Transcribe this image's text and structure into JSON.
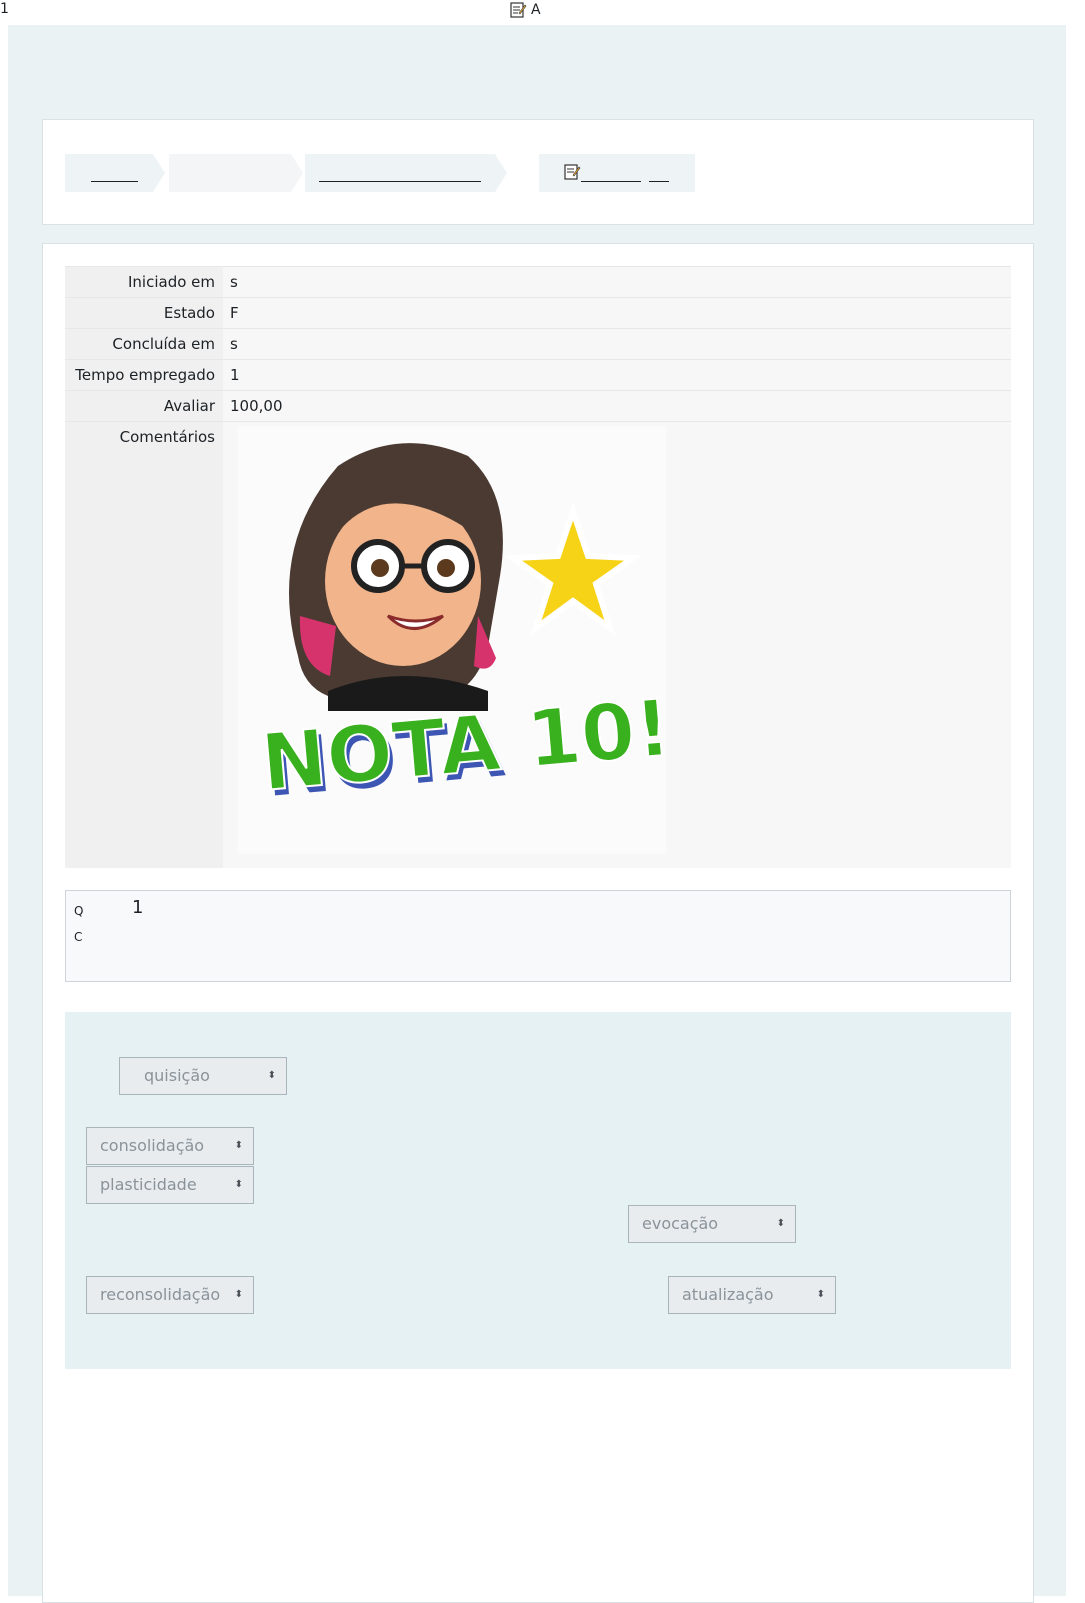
{
  "top": {
    "page_number": "1",
    "title": "A"
  },
  "icons": {
    "quiz": "quiz-icon"
  },
  "summary": [
    {
      "label": "Iniciado em",
      "value": "s"
    },
    {
      "label": "Estado",
      "value": "F"
    },
    {
      "label": "Concluída em",
      "value": "s"
    },
    {
      "label": "Tempo empregado",
      "value": "1"
    },
    {
      "label": "Avaliar",
      "value": "100,00"
    },
    {
      "label": "Comentários",
      "value": ""
    }
  ],
  "sticker": {
    "text": "NOTA 10!"
  },
  "question": {
    "q_label": "Q",
    "number": "1",
    "c_label": "C"
  },
  "dropdowns": {
    "d1": "quisição",
    "d2": "consolidação",
    "d3": "plasticidade",
    "d4": "evocação",
    "d5": "reconsolidação",
    "d6": "atualização"
  },
  "colors": {
    "accent_bg": "#ebf2f4",
    "drop_bg": "#e6f1f3"
  }
}
